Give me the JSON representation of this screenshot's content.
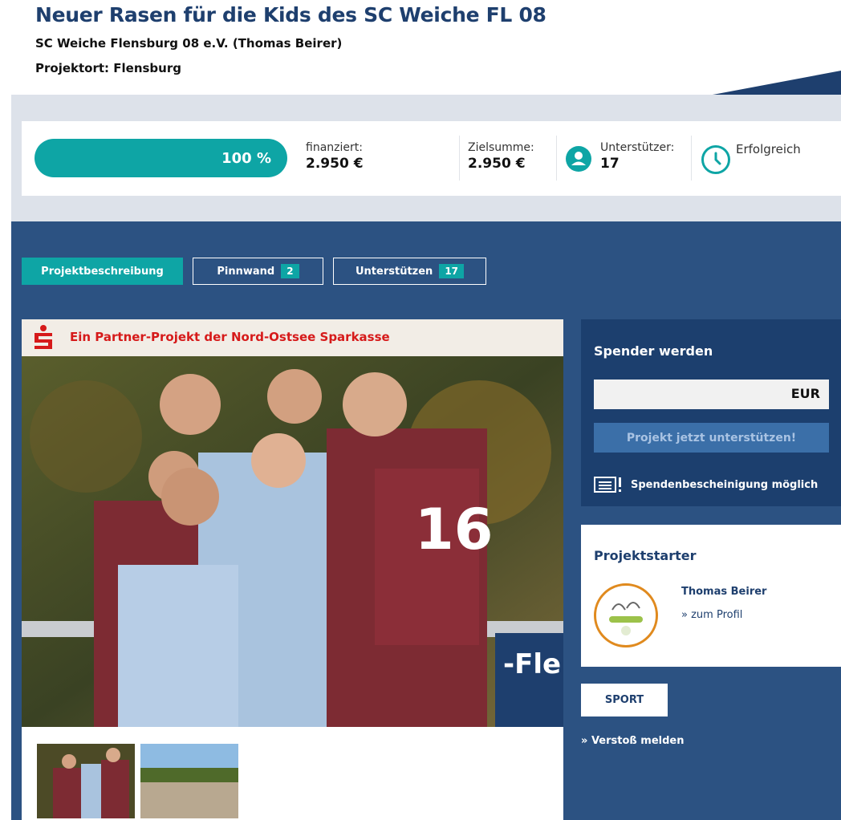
{
  "project": {
    "title": "Neuer Rasen für die Kids des SC Weiche FL 08",
    "organizer": "SC Weiche Flensburg 08 e.V. (Thomas Beirer)",
    "location": "Projektort: Flensburg"
  },
  "stats": {
    "progress_label": "100 %",
    "progress_fraction": 1.0,
    "funded_label": "finanziert:",
    "funded_value": "2.950 €",
    "target_label": "Zielsumme:",
    "target_value": "2.950 €",
    "supporters_label": "Unterstützer:",
    "supporters_value": "17",
    "status": "Erfolgreich"
  },
  "tabs": [
    {
      "label": "Projektbeschreibung",
      "count": ""
    },
    {
      "label": "Pinnwand",
      "count": "2"
    },
    {
      "label": "Unterstützen",
      "count": "17"
    }
  ],
  "partner_banner": "Ein Partner-Projekt der Nord-Ostsee Sparkasse",
  "donate": {
    "heading": "Spender werden",
    "currency": "EUR",
    "button": "Projekt jetzt unterstützen!",
    "receipt_note": "Spendenbescheinigung möglich"
  },
  "starter": {
    "heading": "Projektstarter",
    "name": "Thomas Beirer",
    "profile_link": "zum Profil"
  },
  "category": "SPORT",
  "report_link": "Verstoß melden",
  "colors": {
    "brand_navy": "#2c5282",
    "accent_teal": "#0ea5a5",
    "sparkasse_red": "#d61a1a"
  }
}
